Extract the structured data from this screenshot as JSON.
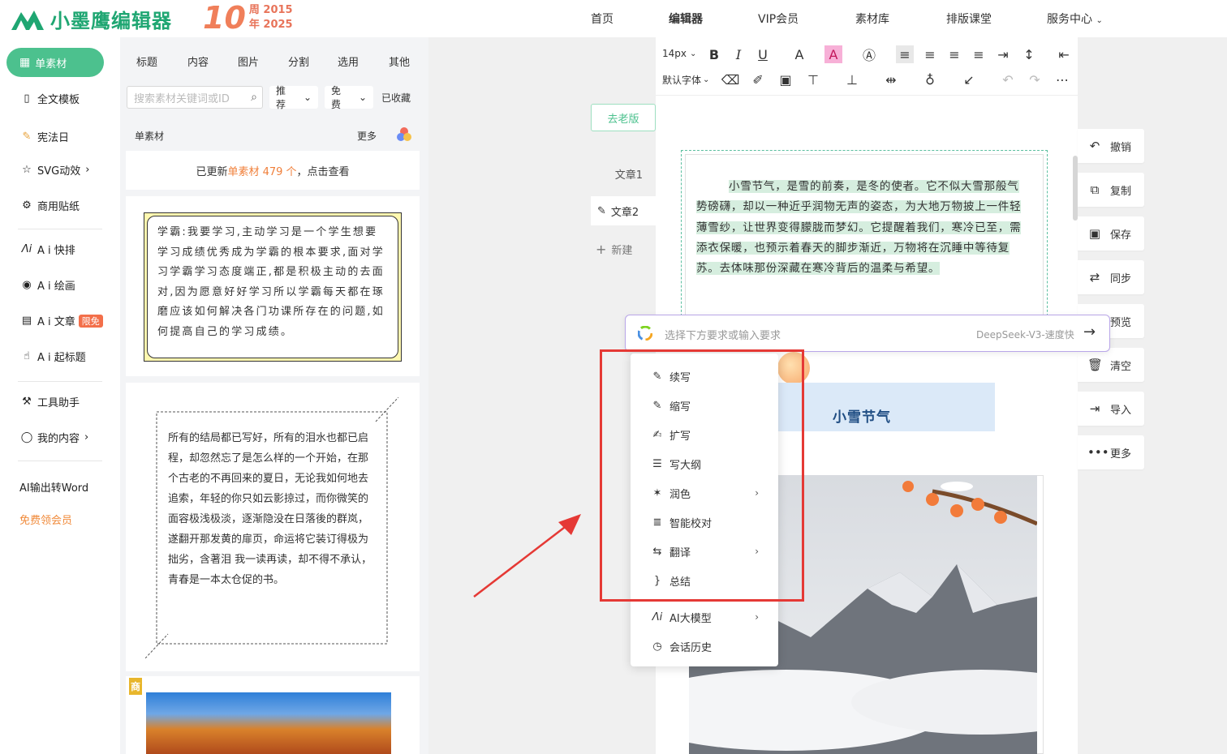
{
  "brand": {
    "name": "小墨鹰编辑器",
    "anniv_num": "10",
    "anniv_line1": "周 2015",
    "anniv_line2": "年 2025"
  },
  "nav": {
    "items": [
      "首页",
      "编辑器",
      "VIP会员",
      "素材库",
      "排版课堂",
      "服务中心"
    ]
  },
  "left_nav": {
    "active": "单素材",
    "items": [
      "全文模板",
      "宪法日",
      "SVG动效",
      "商用贴纸",
      "A i 快排",
      "A i 绘画",
      "A i 文章",
      "A i 起标题",
      "工具助手",
      "我的内容",
      "AI输出转Word",
      "免费领会员"
    ],
    "badge": "限免"
  },
  "panel": {
    "tabs": [
      "标题",
      "内容",
      "图片",
      "分割",
      "选用",
      "其他"
    ],
    "search_placeholder": "搜索素材关键词或ID",
    "filter_recommend": "推荐",
    "filter_free": "免费",
    "filter_saved": "已收藏",
    "section_title": "单素材",
    "section_more": "更多",
    "update_prefix": "已更新",
    "update_highlight": "单素材 479 个",
    "update_suffix": "，点击查看",
    "poem1": "学霸:我要学习,主动学习是一个学生想要学习成绩优秀成为学霸的根本要求,面对学习学霸学习态度端正,都是积极主动的去面对,因为愿意好好学习所以学霸每天都在琢磨应该如何解决各门功课所存在的问题,如何提高自己的学习成绩。",
    "poem2": "所有的结局都已写好，所有的泪水也都已启程，却忽然忘了是怎么样的一个开始，在那个古老的不再回来的夏日，无论我如何地去追索，年轻的你只如云影掠过，而你微笑的面容极浅极淡，逐渐隐没在日落後的群岚，遂翻开那发黄的扉页，命运将它装订得极为拙劣，含著泪 我一读再读，却不得不承认，青春是一本太仓促的书。",
    "shang_badge": "商"
  },
  "toolbar": {
    "font_size": "14px",
    "font_family": "默认字体"
  },
  "articles": {
    "old_version": "去老版",
    "a1": "文章1",
    "a2": "文章2",
    "new": "新建"
  },
  "doc": {
    "text": "小雪节气，是雪的前奏，是冬的使者。它不似大雪那般气势磅礴，却以一种近乎润物无声的姿态，为大地万物披上一件轻薄雪纱，让世界变得朦胧而梦幻。它提醒着我们，寒冷已至，需添衣保暖，也预示着春天的脚步渐近，万物将在沉睡中等待复苏。去体味那份深藏在寒冷背后的温柔与希望。",
    "heading": "小雪节气"
  },
  "right_actions": [
    "撤销",
    "复制",
    "保存",
    "同步",
    "预览",
    "清空",
    "导入",
    "更多"
  ],
  "ai": {
    "placeholder": "选择下方要求或输入要求",
    "model": "DeepSeek-V3-速度快"
  },
  "menu": {
    "items": [
      "续写",
      "缩写",
      "扩写",
      "写大纲",
      "润色",
      "智能校对",
      "翻译",
      "总结",
      "AI大模型",
      "会话历史"
    ]
  },
  "colors": {
    "brand": "#1fa672",
    "active": "#4cc18e",
    "highlight": "#d6eedf",
    "annotation": "#e53935"
  }
}
